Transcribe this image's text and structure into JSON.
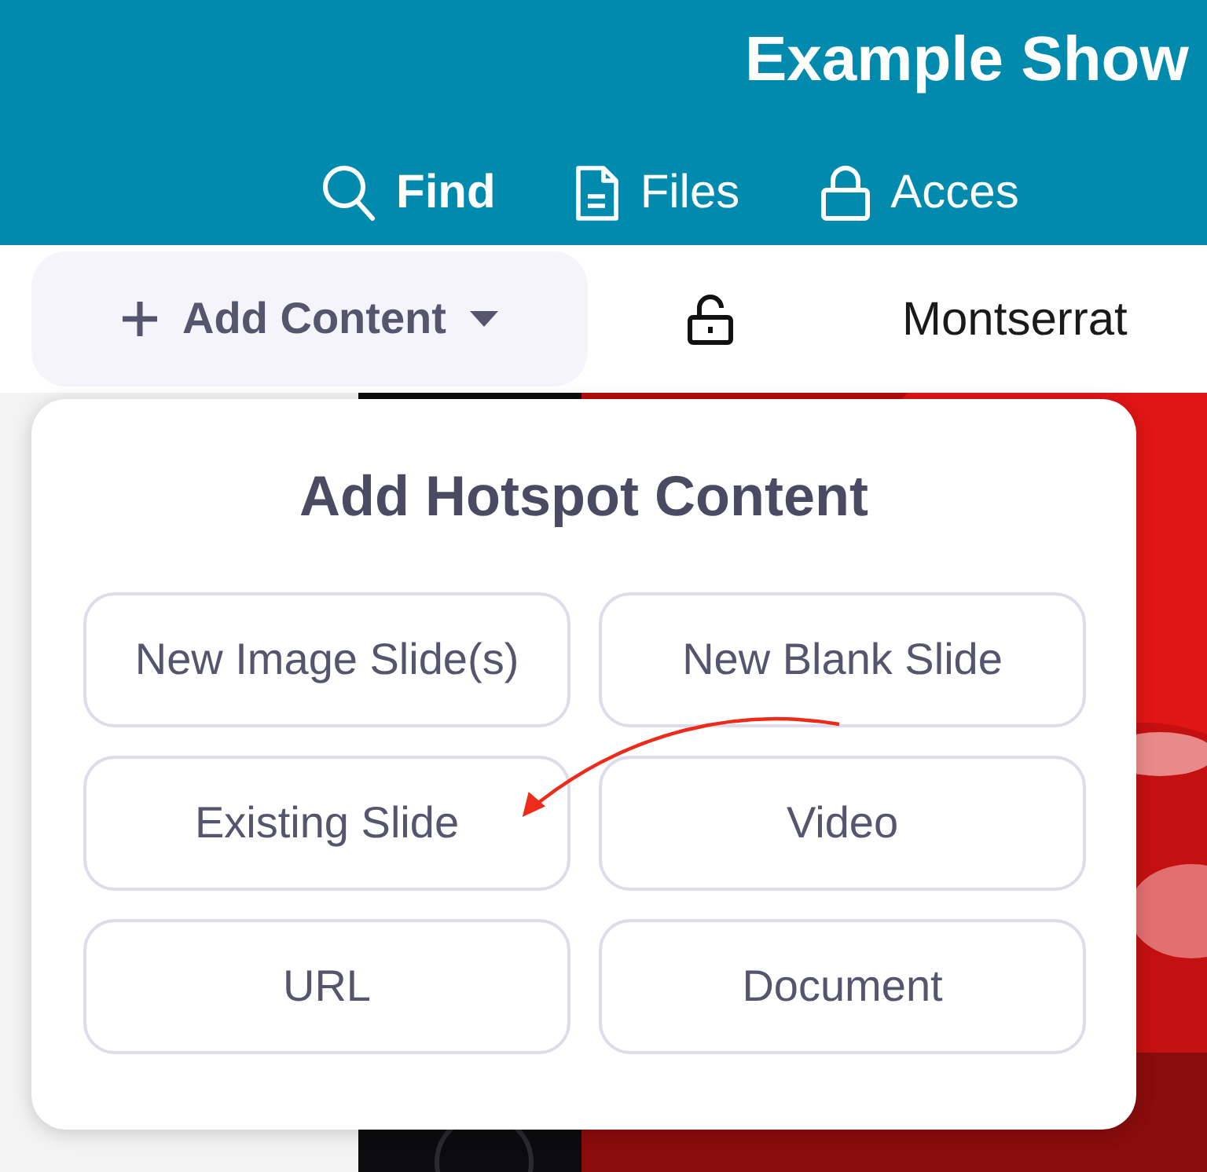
{
  "header": {
    "title": "Example Show",
    "nav": [
      {
        "kind": "search",
        "label": "Find"
      },
      {
        "kind": "file",
        "label": "Files"
      },
      {
        "kind": "lock",
        "label": "Acces"
      }
    ]
  },
  "toolbar": {
    "add_button": {
      "label": "Add Content",
      "expanded": true
    },
    "font": "Montserrat"
  },
  "menu": {
    "title": "Add Hotspot Content",
    "options": [
      "New Image Slide(s)",
      "New Blank Slide",
      "Existing Slide",
      "Video",
      "URL",
      "Document"
    ]
  }
}
